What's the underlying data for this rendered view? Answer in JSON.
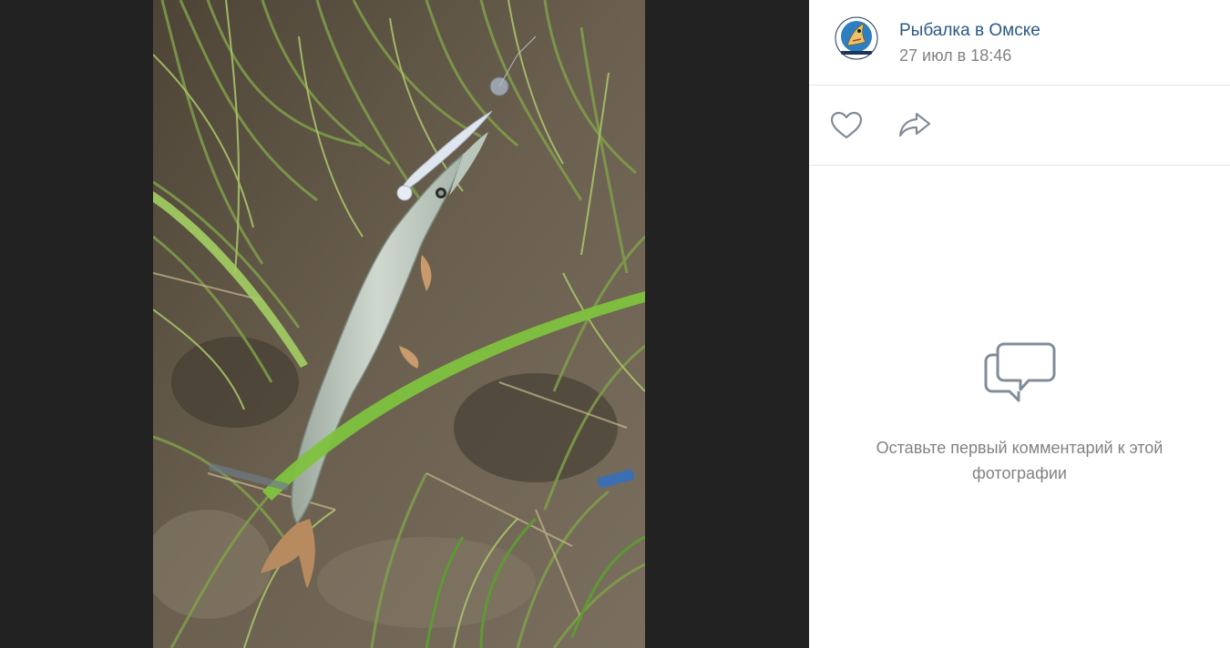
{
  "post": {
    "author": "Рыбалка в Омске",
    "date": "27 июл в 18:46",
    "avatar_text": "РЫБАЛКА В ОМСКЕ"
  },
  "actions": {
    "like_icon": "heart-icon",
    "share_icon": "share-arrow-icon"
  },
  "comments": {
    "empty_icon": "comment-bubbles-icon",
    "empty_text": "Оставьте первый комментарий к этой фотографии"
  },
  "colors": {
    "author_link": "#2a5885",
    "muted": "#828282",
    "icon": "#818c99",
    "backdrop": "#222222",
    "panel": "#ffffff"
  }
}
